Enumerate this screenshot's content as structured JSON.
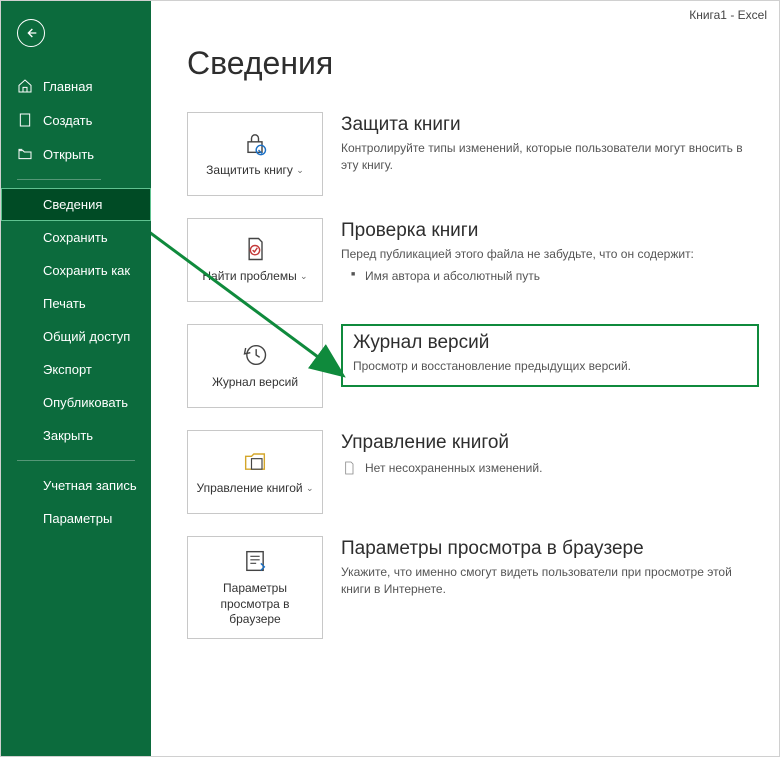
{
  "titlebar": "Книга1  -  Excel",
  "sidebar": {
    "nav": [
      {
        "label": "Главная",
        "icon": "home-icon"
      },
      {
        "label": "Создать",
        "icon": "new-icon"
      },
      {
        "label": "Открыть",
        "icon": "open-icon"
      }
    ],
    "nav2": [
      {
        "label": "Сведения",
        "selected": true
      },
      {
        "label": "Сохранить"
      },
      {
        "label": "Сохранить как"
      },
      {
        "label": "Печать"
      },
      {
        "label": "Общий доступ"
      },
      {
        "label": "Экспорт"
      },
      {
        "label": "Опубликовать"
      },
      {
        "label": "Закрыть"
      }
    ],
    "nav3": [
      {
        "label": "Учетная запись"
      },
      {
        "label": "Параметры"
      }
    ]
  },
  "page_title": "Сведения",
  "sections": {
    "protect": {
      "btn": "Защитить книгу",
      "title": "Защита книги",
      "desc": "Контролируйте типы изменений, которые пользователи могут вносить в эту книгу."
    },
    "inspect": {
      "btn": "Найти проблемы",
      "title": "Проверка книги",
      "desc": "Перед публикацией этого файла не забудьте, что он содержит:",
      "bullet": "Имя автора и абсолютный путь"
    },
    "history": {
      "btn": "Журнал версий",
      "title": "Журнал версий",
      "desc": "Просмотр и восстановление предыдущих версий."
    },
    "manage": {
      "btn": "Управление книгой",
      "title": "Управление книгой",
      "nochanges": "Нет несохраненных изменений."
    },
    "browser": {
      "btn": "Параметры просмотра в браузере",
      "title": "Параметры просмотра в браузере",
      "desc": "Укажите, что именно смогут видеть пользователи при просмотре этой книги в Интернете."
    }
  }
}
